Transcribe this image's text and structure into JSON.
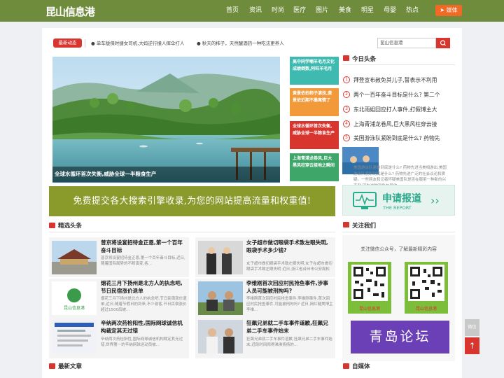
{
  "site": {
    "logo": "昆山信息港"
  },
  "nav": {
    "items": [
      "首页",
      "资讯",
      "时尚",
      "医疗",
      "图片",
      "美食",
      "明星",
      "母婴",
      "热点"
    ],
    "media_button": "媒体"
  },
  "ticker": {
    "badge": "最新动态",
    "items": [
      "单车版保时捷女司机,大妈逆行撞人挥伞打人",
      "秋天的柿子，天然醒酒药一种吃法更养人"
    ]
  },
  "search": {
    "value": "昆山信息港"
  },
  "slider": {
    "caption": "全球水循环首次失衡,威胁全球一半粮食生产"
  },
  "thumb_cards": [
    {
      "text": "高中同学嘲羊毛月文化成绩倒数,阿旺羊毛月"
    },
    {
      "text": "黄景依拍柿子演技,黄景依近期不墨寓情了"
    },
    {
      "text": "全球水循环首次失衡,威胁全球一半粮食生产"
    },
    {
      "text": "上海青浦龙卷风,巨大黑风柱穿云接地之瞬间"
    }
  ],
  "today_headlines": {
    "title": "今日头条",
    "items": [
      "拜登宣布赦免其儿子,誓表示不利用",
      "两个一百年奋斗目标是什么? 第二个",
      "东北雨姐回应打人事件,打假博主大",
      "上海青浦龙卷风,巨大黑风柱穿云接",
      "美国游泳队紧盼到底是什么? 药物先"
    ],
    "description": "美国游泳队紧盼到底是什么? 药物先进当美相游出,美国游泳队紧盼到底是什么? 药物先进广泛的社会议论和质疑。一些网友和记者怀疑美国队是否在服用一种新的兴奋剂,因为这种现象在其他..."
  },
  "banner": {
    "text": "免费提交各大搜索引擎收录,为您的网站提高流量和权重值!"
  },
  "report": {
    "title": "申请报道",
    "subtitle": "THE REPORT"
  },
  "featured": {
    "title": "精选头条",
    "cards": [
      {
        "title": "普京将设宴招待金正恩,第一个百年奋斗目标",
        "desc": "普京将设宴招待金正恩,第一个百年奋斗目标,近日,随着国际局势的不断演变,各..."
      },
      {
        "title": "女子超市做切眼袋手术致左眼失明,眼袋手术多少钱?",
        "desc": "女子超市做切眼袋手术致左眼失明,女子在超市做切眼袋手术致左眼失明 近日,浙江省台州市公安局松山区..."
      },
      {
        "title": "烟花三月下扬州是北方人的执念吧,节日民宿涨价退单",
        "desc": "烟花三月下扬州是北方人的执念吧,节日民宿涨价退单,近日,随着节假日的到来,不少游客,节日民宿涨价超过1500后被..."
      },
      {
        "title": "李维刚首次回应村民抢鱼事件,涉事人员可能被刑拘吗?",
        "desc": "李维刚首次回应村民抢鱼事件,李维刚事件,首次回应村民抢鱼事件,可能被刑拘吗? 近日,网红健美博主李维..."
      },
      {
        "title": "辛纳两次药检阳性,国际网球诚信机构裁定其无过错",
        "desc": "辛纳两次药检阳性,国际网球诚信机构裁定其无过错,世界第一的辛纳网球运动员被..."
      },
      {
        "title": "狂飙兄弟就二手车事件道歉,狂飙兄弟二手车事件始末",
        "desc": "狂飙兄弟就二手车事件道歉,狂飙兄弟二手车事件始末,近段时间闹得沸沸扬扬的..."
      }
    ]
  },
  "follow": {
    "title": "关注我们",
    "text": "关注微信公众号，了解最新精彩内容",
    "qr_label": "昆山信息港",
    "qingdao": "青岛论坛"
  },
  "latest": {
    "title": "最新文章"
  },
  "self_media": {
    "title": "自媒体"
  },
  "side_buttons": {
    "wechat": "微信",
    "top": "↑"
  },
  "colors": {
    "brand_green": "#6f8c3c",
    "accent_red": "#d9352f",
    "banner_olive": "#8a9b2b",
    "purple": "#6b3fb5"
  }
}
